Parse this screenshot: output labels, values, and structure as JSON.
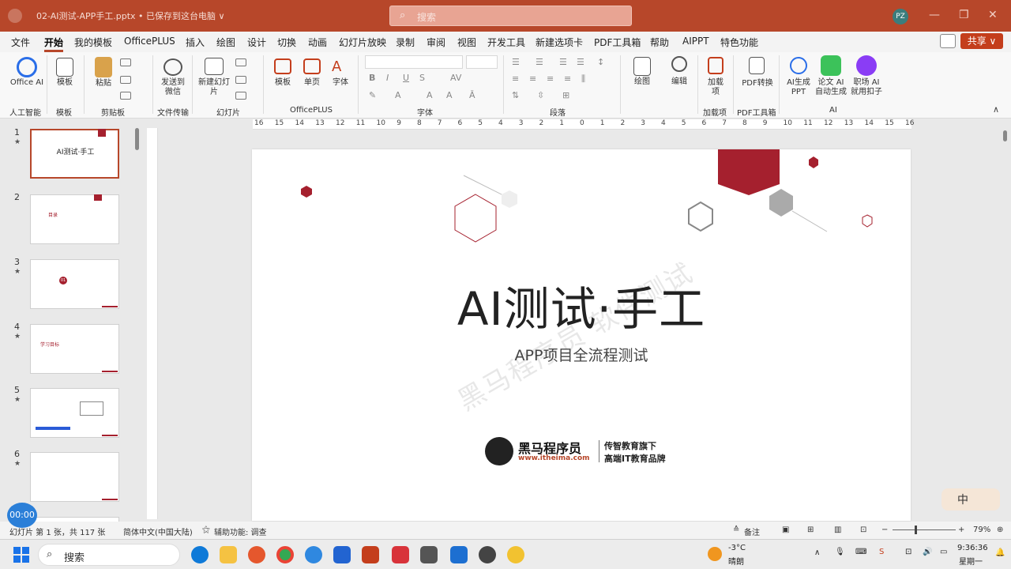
{
  "window": {
    "doc_title": "02-AI测试-APP手工.pptx • 已保存到这台电脑 ∨",
    "search_placeholder": "搜索",
    "avatar_initials": "PZ"
  },
  "menu": {
    "tabs": [
      "文件",
      "开始",
      "我的模板",
      "OfficePLUS",
      "插入",
      "绘图",
      "设计",
      "切换",
      "动画",
      "幻灯片放映",
      "录制",
      "审阅",
      "视图",
      "开发工具",
      "新建选项卡",
      "PDF工具箱",
      "帮助",
      "AIPPT",
      "特色功能"
    ],
    "active_tab": "开始",
    "share_label": "共享"
  },
  "ribbon": {
    "office_ai": "Office AI",
    "template": "模板",
    "paste": "粘贴",
    "send_wechat": "发送到微信",
    "new_slide": "新建幻灯片",
    "opl_template": "模板",
    "opl_single": "单页",
    "opl_font": "字体",
    "drawing": "绘图",
    "editing": "编辑",
    "addin": "加载项",
    "pdf_convert": "PDF转换",
    "ai_ppt": "AI生成PPT",
    "ai_paper": "论文 AI 自动生成",
    "ai_job": "职场 AI 就用扣子",
    "groups": {
      "ai_assistant": "人工智能",
      "templates": "模板",
      "clipboard": "剪贴板",
      "file_transfer": "文件传输",
      "slides": "幻灯片",
      "officeplus": "OfficePLUS",
      "font": "字体",
      "paragraph": "段落",
      "addins": "加载项",
      "pdf_toolbox": "PDF工具箱",
      "ai": "AI"
    }
  },
  "thumbnails": [
    {
      "num": "1",
      "title": "AI测试·手工"
    },
    {
      "num": "2",
      "title": "目录"
    },
    {
      "num": "3",
      "title": "01"
    },
    {
      "num": "4",
      "title": "学习目标"
    },
    {
      "num": "5",
      "title": ""
    },
    {
      "num": "6",
      "title": ""
    }
  ],
  "ruler": [
    "16",
    "15",
    "14",
    "13",
    "12",
    "11",
    "10",
    "9",
    "8",
    "7",
    "6",
    "5",
    "4",
    "3",
    "2",
    "1",
    "0",
    "1",
    "2",
    "3",
    "4",
    "5",
    "6",
    "7",
    "8",
    "9",
    "10",
    "11",
    "12",
    "13",
    "14",
    "15",
    "16"
  ],
  "slide": {
    "title": "AI测试·手工",
    "subtitle": "APP项目全流程测试",
    "watermark": "黑马程序员 软件测试",
    "brand_name": "黑马程序员",
    "brand_url": "www.itheima.com",
    "brand_tag1": "传智教育旗下",
    "brand_tag2": "高端IT教育品牌",
    "accent": "#a5202e"
  },
  "status": {
    "slide_info": "幻灯片 第 1 张，共 117 张",
    "language": "简体中文(中国大陆)",
    "accessibility": "辅助功能: 调查",
    "notes": "备注",
    "zoom": "79%"
  },
  "timer": "00:00",
  "ime": "中",
  "taskbar": {
    "search": "搜索",
    "weather_temp": "-3°C",
    "weather_desc": "晴朗",
    "time": "9:36:36",
    "day": "星期一"
  }
}
